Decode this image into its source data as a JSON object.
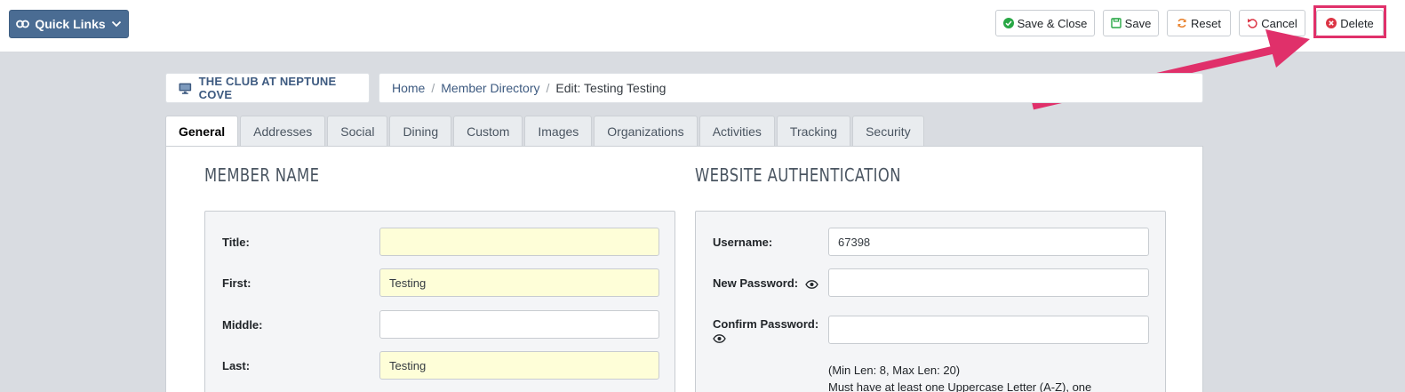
{
  "toolbar": {
    "quick_links": "Quick Links",
    "save_close": "Save & Close",
    "save": "Save",
    "reset": "Reset",
    "cancel": "Cancel",
    "delete": "Delete"
  },
  "club_name": "THE CLUB AT NEPTUNE COVE",
  "breadcrumb": {
    "home": "Home",
    "directory": "Member Directory",
    "current": "Edit: Testing Testing"
  },
  "tabs": [
    "General",
    "Addresses",
    "Social",
    "Dining",
    "Custom",
    "Images",
    "Organizations",
    "Activities",
    "Tracking",
    "Security"
  ],
  "member_name": {
    "title": "MEMBER NAME",
    "title_label": "Title:",
    "title_value": "",
    "first_label": "First:",
    "first_value": "Testing",
    "middle_label": "Middle:",
    "middle_value": "",
    "last_label": "Last:",
    "last_value": "Testing"
  },
  "website_auth": {
    "title": "WEBSITE AUTHENTICATION",
    "username_label": "Username:",
    "username_value": "67398",
    "new_password_label": "New Password:",
    "confirm_password_label": "Confirm Password:",
    "hint_line1": "(Min Len: 8, Max Len: 20)",
    "hint_line2": "Must have at least one Uppercase Letter (A-Z), one"
  },
  "colors": {
    "primary": "#4a6c93",
    "highlight": "#e0306a",
    "required_bg": "#fefed8",
    "delete_icon": "#dc3545",
    "success_icon": "#28a745"
  }
}
